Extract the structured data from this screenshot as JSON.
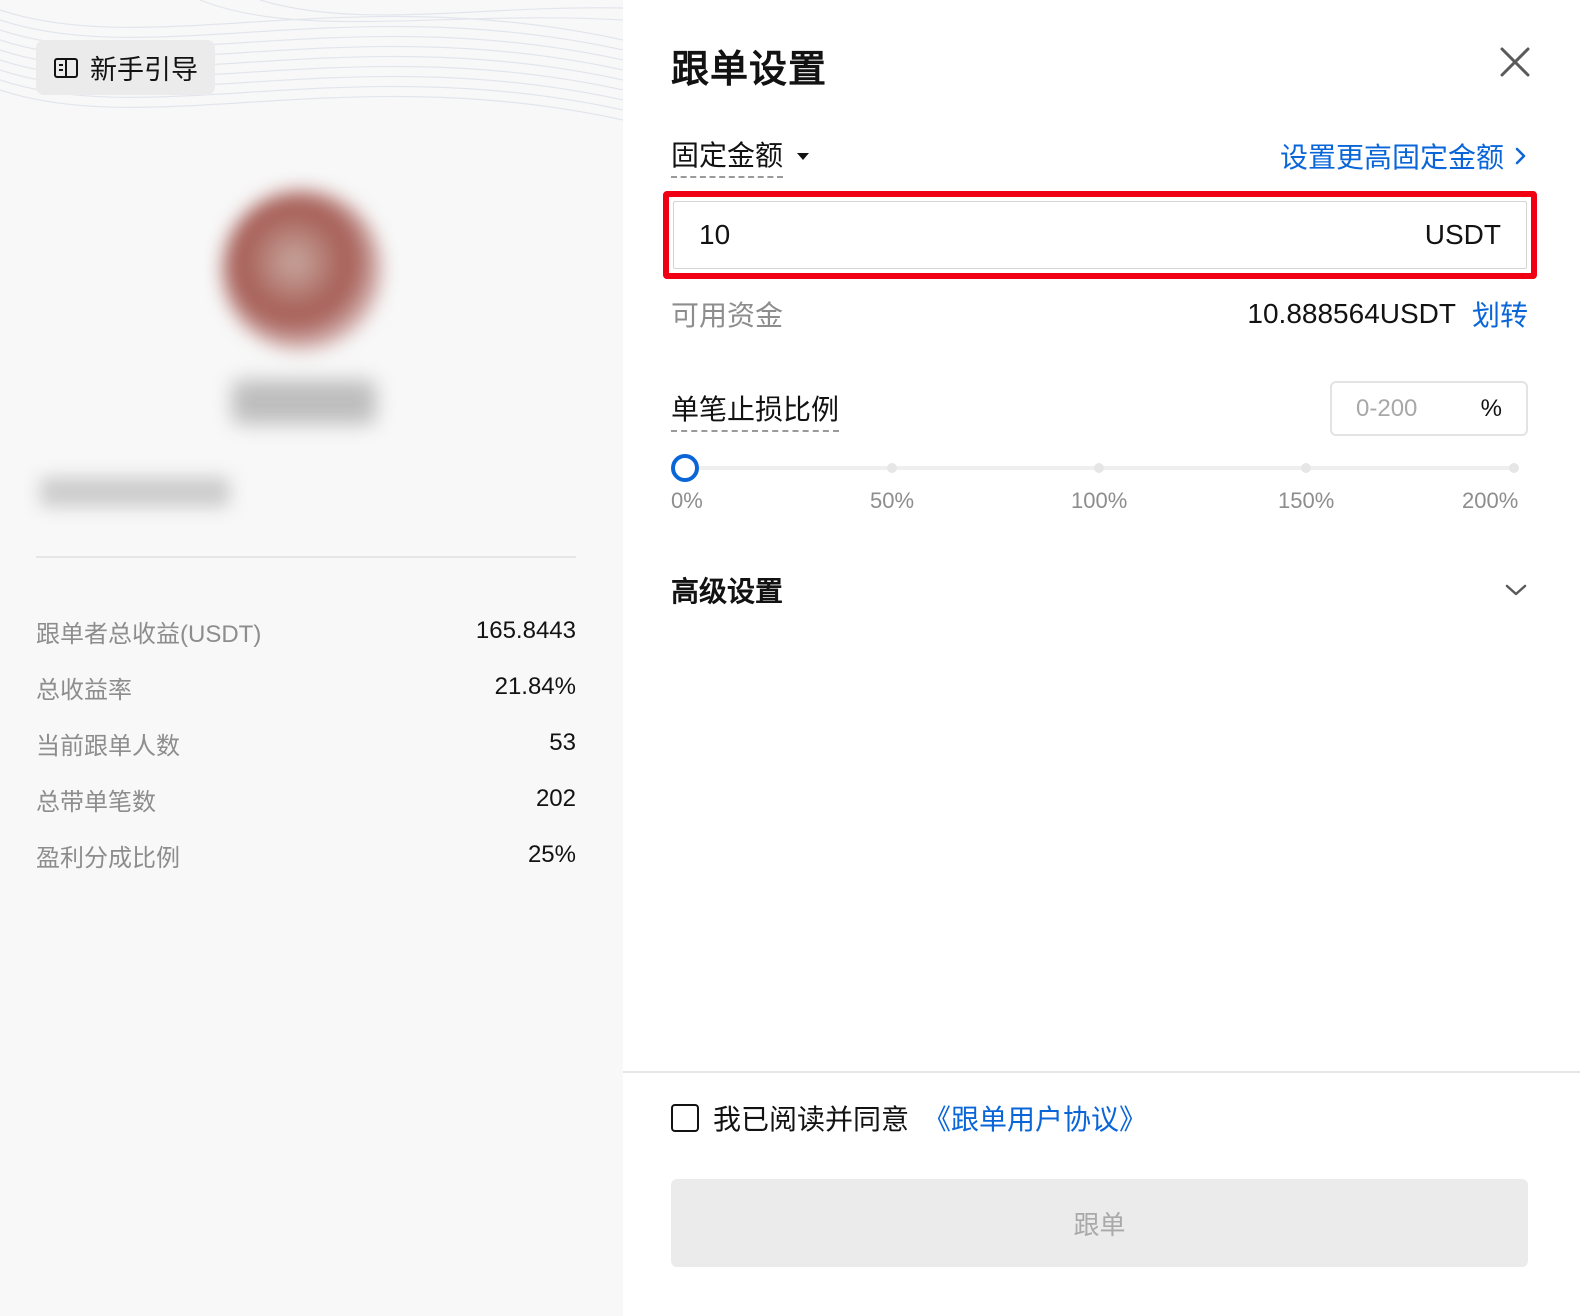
{
  "left_panel": {
    "guide_button": {
      "label": "新手引导",
      "icon": "guide-book-icon"
    },
    "stats": [
      {
        "label": "跟单者总收益(USDT)",
        "value": "165.8443"
      },
      {
        "label": "总收益率",
        "value": "21.84%"
      },
      {
        "label": "当前跟单人数",
        "value": "53"
      },
      {
        "label": "总带单笔数",
        "value": "202"
      },
      {
        "label": "盈利分成比例",
        "value": "25%"
      }
    ]
  },
  "right_panel": {
    "title": "跟单设置",
    "close_icon": "close-icon",
    "mode": {
      "label": "固定金额",
      "icon": "caret-down-icon"
    },
    "higher_amount_link": "设置更高固定金额",
    "amount": {
      "value": "10",
      "unit": "USDT"
    },
    "available": {
      "label": "可用资金",
      "value": "10.888564USDT",
      "transfer": "划转"
    },
    "stop_loss": {
      "label": "单笔止损比例",
      "placeholder": "0-200",
      "unit": "%",
      "slider_value_percent": 0,
      "marks": [
        "0%",
        "50%",
        "100%",
        "150%",
        "200%"
      ]
    },
    "advanced": {
      "label": "高级设置",
      "icon": "chevron-down-icon"
    },
    "agreement": {
      "text": "我已阅读并同意",
      "link": "《跟单用户协议》",
      "checked": false
    },
    "submit_button": "跟单"
  },
  "colors": {
    "accent": "#0a66d8",
    "highlight_border": "#f00012",
    "muted_text": "#8d8d8d",
    "disabled_button_bg": "#ebebeb"
  }
}
